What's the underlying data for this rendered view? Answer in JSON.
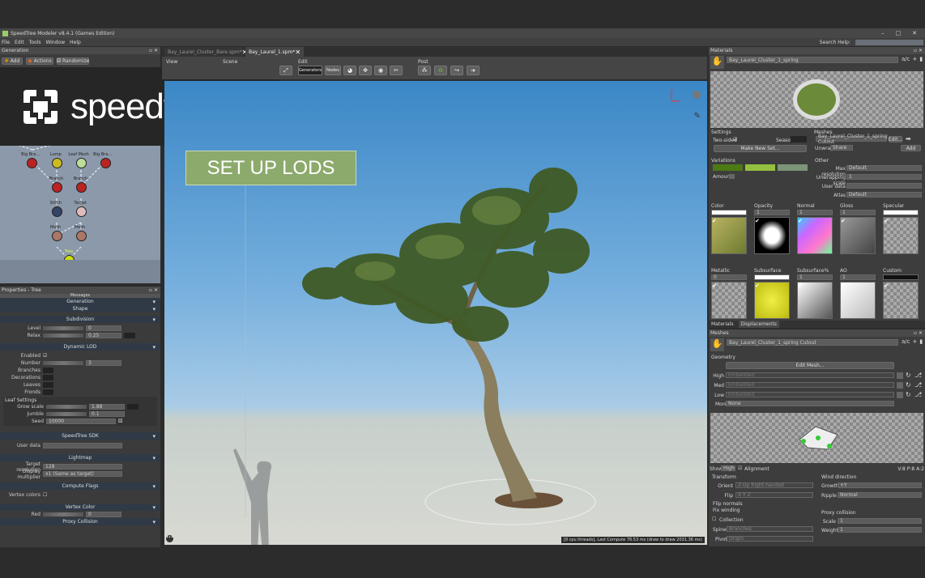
{
  "window": {
    "title": "SpeedTree Modeler v8.4.1 (Games Edition)",
    "minimize": "–",
    "maximize": "□",
    "close": "✕"
  },
  "menu": [
    "File",
    "Edit",
    "Tools",
    "Window",
    "Help"
  ],
  "search_help": "Search Help:",
  "generation": {
    "title": "Generation",
    "add": "Add",
    "actions": "Actions",
    "randomize": "Randomize",
    "nodes": [
      "Big Bra...",
      "Lump",
      "Leaf Mesh",
      "Big Bra...",
      "Branch",
      "Branch",
      "Stitch",
      "Target",
      "Mesh",
      "Mesh",
      "Tree"
    ]
  },
  "logo": {
    "text": "speedtree"
  },
  "overlay_label": "SET UP LODS",
  "properties": {
    "title": "Properties - Tree",
    "messages": "Messages",
    "sections": {
      "generation": "Generation",
      "shape": "Shape",
      "subdivision": "Subdivision",
      "dynamic_lod": "Dynamic LOD",
      "sdk": "SpeedTree SDK",
      "lightmap": "Lightmap",
      "compute_flags": "Compute Flags",
      "vertex_color": "Vertex Color",
      "proxy_collision": "Proxy Collision"
    },
    "level_label": "Level",
    "level": "0",
    "relax_label": "Relax",
    "relax": "0.25",
    "enabled_label": "Enabled",
    "number_label": "Number",
    "number": "3",
    "curves": [
      "Branches",
      "Decorations",
      "Leaves",
      "Fronds"
    ],
    "leaf_settings": "Leaf Settings",
    "grow_scale_label": "Grow scale",
    "grow_scale": "1.88",
    "jumble_label": "Jumble",
    "jumble": "0.1",
    "seed_label": "Seed",
    "seed": "10000",
    "user_data_label": "User data",
    "target_res_label": "Target resolution",
    "target_res": "128",
    "display_mult_label": "Display multiplier",
    "display_mult": "x1 (Same as target)",
    "vertex_colors_label": "Vertex colors",
    "red_label": "Red",
    "red": "0"
  },
  "tabs": [
    {
      "label": "Bay_Laurel_Cluster_Bare.spm*",
      "active": false
    },
    {
      "label": "Bay_Laurel_1.spm*",
      "active": true
    }
  ],
  "toolbar": {
    "view": "View",
    "scene": "Scene",
    "edit": "Edit",
    "post": "Post",
    "generators": "Generators",
    "nodes": "Nodes"
  },
  "viewport": {
    "status": "[8 cpu threads], Last Compute 76.53 ms (draw to draw 2031.36 ms)"
  },
  "materials": {
    "title": "Materials",
    "selected": "Bay_Laurel_Cluster_1_spring",
    "settings": "Settings",
    "two_sided": "Two-sided",
    "season": "Season",
    "make_new_set": "Make New Set...",
    "variations": "Variations",
    "variation_colors": [
      "#4d7a14",
      "#94c040",
      "#7c9478"
    ],
    "amount": "Amount",
    "meshes": "Meshes",
    "mesh_value": "Bay_Laurel_Cluster_1_spring Cutout",
    "edit": "Edit...",
    "unwrap": "Unwrap",
    "unwrap_value": "Share",
    "add": "Add",
    "other": "Other",
    "max_res": "Max resolution",
    "max_res_value": "Default",
    "unwrap_scale": "Unwrapping scale",
    "unwrap_scale_value": "1",
    "user_data": "User data",
    "atlas": "Atlas",
    "atlas_value": "Default",
    "maps": [
      {
        "label": "Color",
        "value": ""
      },
      {
        "label": "Opacity",
        "value": "1"
      },
      {
        "label": "Normal",
        "value": "1"
      },
      {
        "label": "Gloss",
        "value": "1"
      },
      {
        "label": "Specular",
        "value": ""
      },
      {
        "label": "Metallic",
        "value": "0"
      },
      {
        "label": "Subsurface",
        "value": ""
      },
      {
        "label": "Subsurface%",
        "value": "1"
      },
      {
        "label": "AO",
        "value": "1"
      },
      {
        "label": "Custom",
        "value": ""
      }
    ],
    "tab_materials": "Materials",
    "tab_displacements": "Displacements"
  },
  "meshes": {
    "title": "Meshes",
    "selected": "Bay_Laurel_Cluster_1_spring Cutout",
    "geometry": "Geometry",
    "edit_mesh": "Edit Mesh...",
    "lods": [
      {
        "label": "High",
        "value": "Embedded"
      },
      {
        "label": "Med",
        "value": "Embedded"
      },
      {
        "label": "Low",
        "value": "Embedded"
      }
    ],
    "more_label": "More",
    "more": "None",
    "show": "Show",
    "show_value": "High",
    "alignment": "Alignment",
    "stats": "V:8 P:8 A:2",
    "transform": "Transform",
    "orient_label": "Orient",
    "orient": "Z-Up Right-handed",
    "flip_label": "Flip",
    "flip": "X Y Z",
    "flip_normals": "Flip normals",
    "fix_winding": "Fix winding",
    "collection": "Collection",
    "spines_label": "Spines",
    "spines": "Branches",
    "pivot_label": "Pivot",
    "pivot": "Origin",
    "wind_direction": "Wind direction",
    "growth_label": "Growth",
    "growth": "+Y",
    "ripple_label": "Ripple",
    "ripple": "Normal",
    "proxy_collision": "Proxy collision",
    "scale_label": "Scale",
    "scale": "1",
    "weight_label": "Weight",
    "weight": "1"
  }
}
